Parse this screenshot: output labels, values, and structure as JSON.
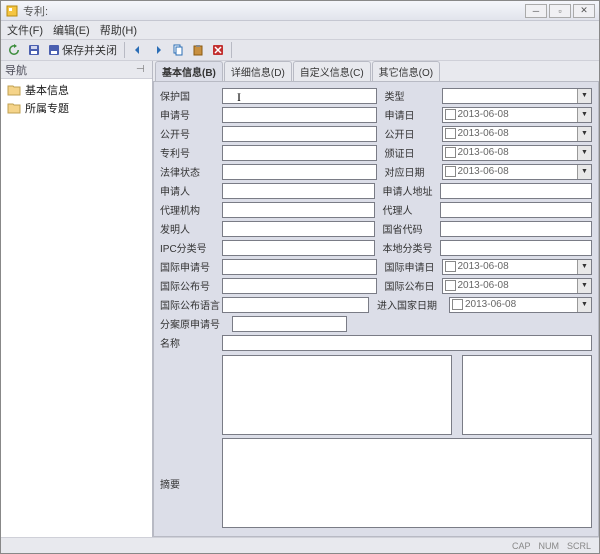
{
  "window": {
    "title": "专利:"
  },
  "menu": {
    "file": "文件(F)",
    "edit": "编辑(E)",
    "help": "帮助(H)"
  },
  "toolbar": {
    "save_close": "保存并关闭"
  },
  "nav": {
    "title": "导航",
    "items": [
      "基本信息",
      "所属专题"
    ]
  },
  "tabs": [
    "基本信息(B)",
    "详细信息(D)",
    "自定义信息(C)",
    "其它信息(O)"
  ],
  "fields": {
    "protect_country": "保护国",
    "type": "类型",
    "app_no": "申请号",
    "app_date": "申请日",
    "pub_no": "公开号",
    "pub_date": "公开日",
    "patent_no": "专利号",
    "grant_date": "颁证日",
    "legal_status": "法律状态",
    "corr_date": "对应日期",
    "applicant": "申请人",
    "applicant_addr": "申请人地址",
    "agency": "代理机构",
    "agent": "代理人",
    "inventor": "发明人",
    "country_code": "国省代码",
    "ipc": "IPC分类号",
    "local_class": "本地分类号",
    "intl_app_no": "国际申请号",
    "intl_app_date": "国际申请日",
    "intl_pub_no": "国际公布号",
    "intl_pub_date": "国际公布日",
    "intl_pub_lang": "国际公布语言",
    "enter_national_date": "进入国家日期",
    "div_app_no": "分案原申请号",
    "name": "名称",
    "abstract": "摘要"
  },
  "date_default": "2013-06-08",
  "status": {
    "cap": "CAP",
    "num": "NUM",
    "scrl": "SCRL"
  }
}
